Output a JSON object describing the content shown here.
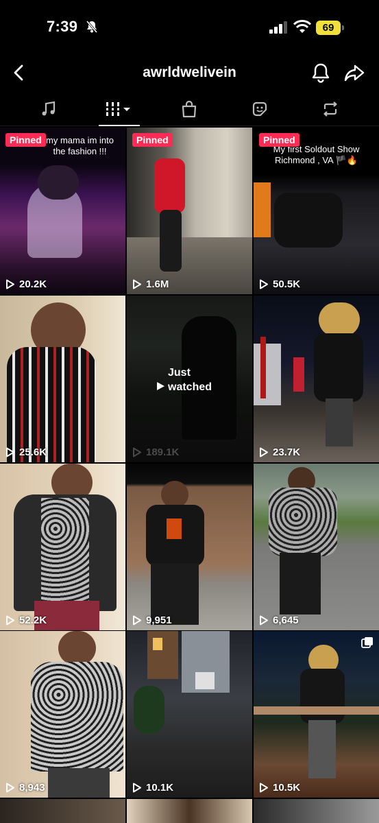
{
  "status_bar": {
    "time": "7:39",
    "battery": "69"
  },
  "header": {
    "username": "awrldwelivein"
  },
  "tabs": [
    "music-icon",
    "videos-grid-icon",
    "shop-bag-icon",
    "sticker-icon",
    "repost-icon"
  ],
  "grid": [
    {
      "views": "20.2K",
      "pinned": "Pinned",
      "caption": "my mama im into the fashion !!!"
    },
    {
      "views": "1.6M",
      "pinned": "Pinned"
    },
    {
      "views": "50.5K",
      "pinned": "Pinned",
      "caption": "My first Soldout Show Richmond , VA 🏴🔥"
    },
    {
      "views": "25.6K"
    },
    {
      "views": "189.1K",
      "overlay": "Just watched"
    },
    {
      "views": "23.7K"
    },
    {
      "views": "52.2K"
    },
    {
      "views": "9,951"
    },
    {
      "views": "6,645"
    },
    {
      "views": "8,943"
    },
    {
      "views": "10.1K"
    },
    {
      "views": "10.5K"
    }
  ],
  "colors": {
    "accent": "#fe2c55",
    "battery": "#f2e03a"
  }
}
